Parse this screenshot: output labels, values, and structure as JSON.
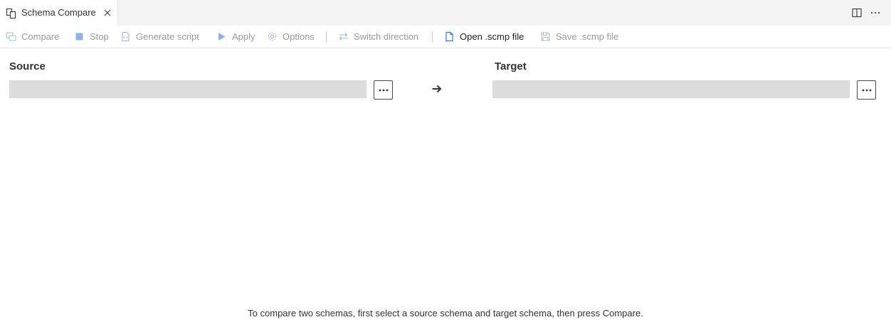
{
  "tab": {
    "title": "Schema Compare",
    "icon": "schema-compare-icon"
  },
  "tab_actions": [
    "split-editor-icon",
    "more-actions-icon"
  ],
  "toolbar": {
    "compare": "Compare",
    "stop": "Stop",
    "generate_script": "Generate script",
    "apply": "Apply",
    "options": "Options",
    "switch_direction": "Switch direction",
    "open_scmp": "Open .scmp file",
    "save_scmp": "Save .scmp file"
  },
  "source": {
    "label": "Source",
    "value": "",
    "browse": "..."
  },
  "target": {
    "label": "Target",
    "value": "",
    "browse": "..."
  },
  "hint": "To compare two schemas, first select a source schema and target schema, then press Compare.",
  "colors": {
    "disabled_text": "#9a9a9a",
    "enabled_text": "#1f1f1f",
    "accent": "#3574f0",
    "box": "#dcdcdc"
  }
}
